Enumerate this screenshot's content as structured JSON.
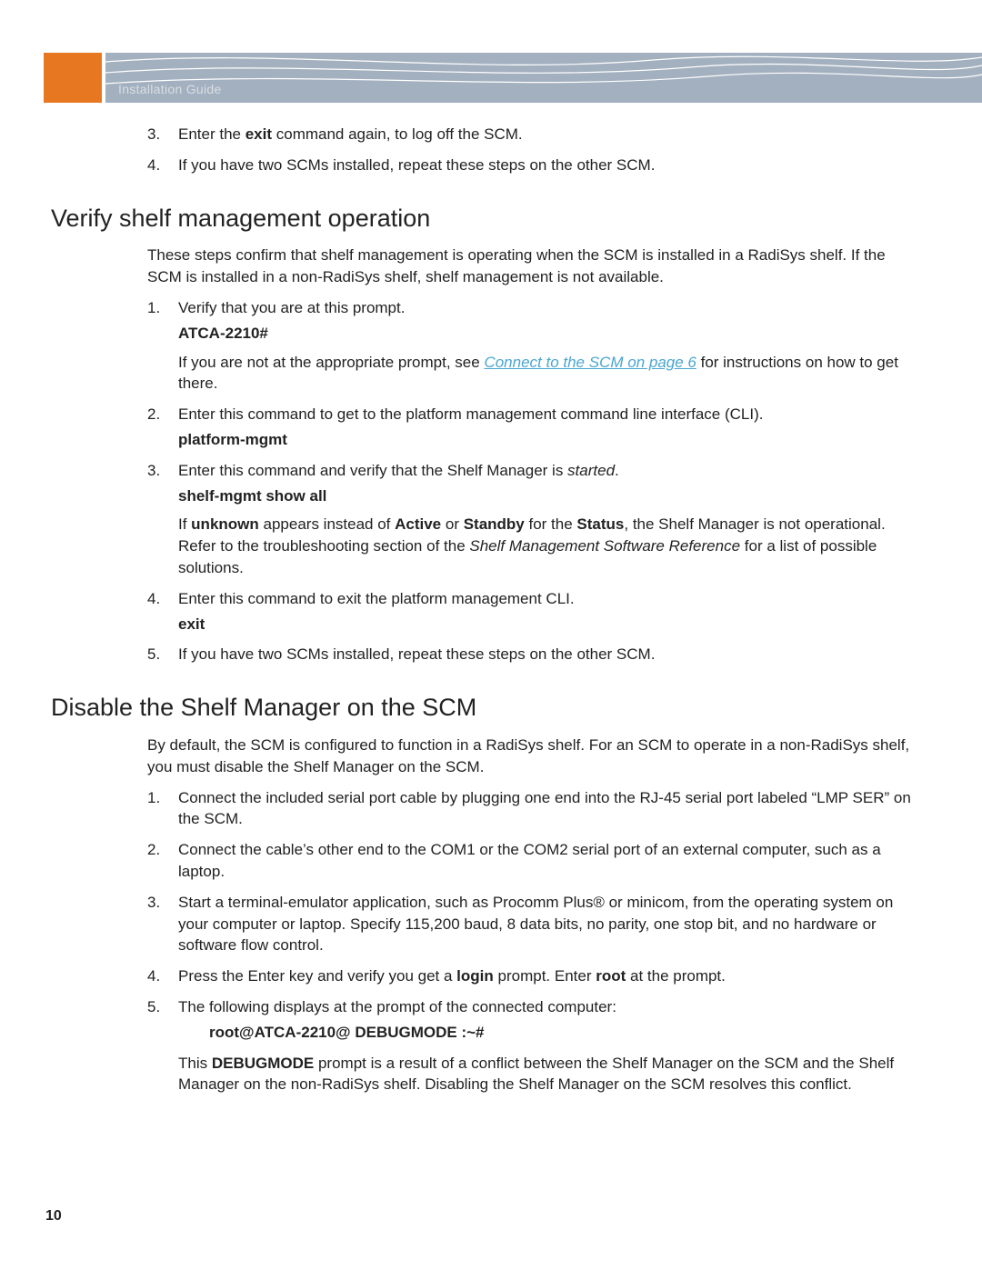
{
  "header": {
    "guide_label": "Installation Guide"
  },
  "top_list": {
    "i3": {
      "num": "3.",
      "a": "Enter the ",
      "b": "exit",
      "c": " command again, to log off the SCM."
    },
    "i4": {
      "num": "4.",
      "text": "If you have two SCMs installed, repeat these steps on the other SCM."
    }
  },
  "section1": {
    "title": "Verify shelf management operation",
    "intro": "These steps confirm that shelf management is operating when the SCM is installed in a RadiSys shelf. If the SCM is installed in a non-RadiSys shelf, shelf management is not available.",
    "i1": {
      "num": "1.",
      "text": "Verify that you are at this prompt.",
      "prompt": "ATCA-2210#",
      "note_a": "If you are not at the appropriate prompt, see ",
      "note_link": "Connect to the SCM",
      "note_link2": " on page 6",
      "note_b": " for instructions on how to get there."
    },
    "i2": {
      "num": "2.",
      "text": "Enter this command to get to the platform management command line interface (CLI).",
      "cmd": "platform-mgmt"
    },
    "i3": {
      "num": "3.",
      "a": "Enter this command and verify that the Shelf Manager is ",
      "b": "started",
      "c": ".",
      "cmd": "shelf-mgmt show all",
      "n_a": "If ",
      "n_b": "unknown",
      "n_c": " appears instead of ",
      "n_d": "Active",
      "n_e": " or ",
      "n_f": "Standby",
      "n_g": " for the ",
      "n_h": "Status",
      "n_i": ", the Shelf Manager is not operational. Refer to the troubleshooting section of the ",
      "n_j": "Shelf Management Software Reference",
      "n_k": " for a list of possible solutions."
    },
    "i4": {
      "num": "4.",
      "text": "Enter this command to exit the platform management CLI.",
      "cmd": "exit"
    },
    "i5": {
      "num": "5.",
      "text": "If you have two SCMs installed, repeat these steps on the other SCM."
    }
  },
  "section2": {
    "title": "Disable the Shelf Manager on the SCM",
    "intro": "By default, the SCM is configured to function in a RadiSys shelf. For an SCM to operate in a non-RadiSys shelf, you must disable the Shelf Manager on the SCM.",
    "i1": {
      "num": "1.",
      "text": "Connect the included serial port cable by plugging one end into the RJ-45 serial port labeled “LMP SER” on the SCM."
    },
    "i2": {
      "num": "2.",
      "text": "Connect the cable’s other end to the COM1 or the COM2 serial port of an external computer, such as a laptop."
    },
    "i3": {
      "num": "3.",
      "text": "Start a terminal-emulator application, such as Procomm Plus® or minicom, from the operating system on your computer or laptop. Specify 115,200 baud, 8 data bits, no parity, one stop bit, and no hardware or software flow control."
    },
    "i4": {
      "num": "4.",
      "a": "Press the Enter key and verify you get a ",
      "b": "login",
      "c": " prompt. Enter ",
      "d": "root",
      "e": " at the prompt."
    },
    "i5": {
      "num": "5.",
      "text": "The following displays at the prompt of the connected computer:",
      "prompt": "root@ATCA-2210@ DEBUGMODE :~#",
      "n_a": "This ",
      "n_b": "DEBUGMODE",
      "n_c": " prompt is a result of a conflict between the Shelf Manager on the SCM and the Shelf Manager on the non-RadiSys shelf. Disabling the Shelf Manager on the SCM resolves this conflict."
    }
  },
  "page_number": "10"
}
